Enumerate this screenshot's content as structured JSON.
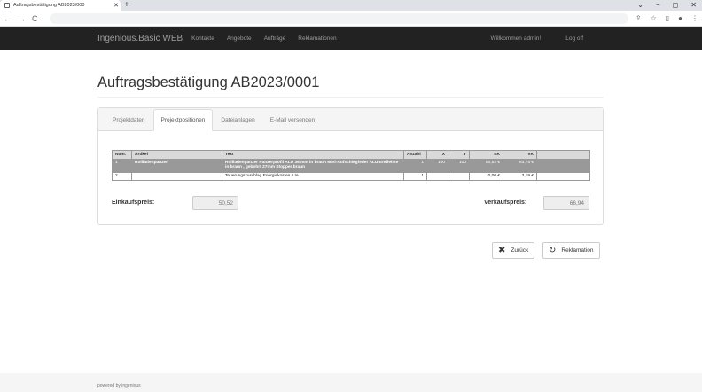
{
  "browser": {
    "tab_title": "Auftragsbestätigung AB2023/000",
    "tab_close": "✕",
    "new_tab": "+",
    "back": "←",
    "forward": "→",
    "reload": "C",
    "win_min": "⌄",
    "win_minimize": "−",
    "win_restore": "◻",
    "win_close": "✕",
    "share_icon": "⇪",
    "star_icon": "☆",
    "sidepanel_icon": "▯",
    "profile_icon": "●",
    "menu_icon": "⋮"
  },
  "navbar": {
    "brand": "Ingenious.Basic WEB",
    "links": [
      "Kontakte",
      "Angebote",
      "Aufträge",
      "Reklamationen"
    ],
    "welcome": "Willkommen admin!",
    "logout": "Log off"
  },
  "page": {
    "title": "Auftragsbestätigung AB2023/0001"
  },
  "tabs": [
    "Projektdaten",
    "Projektpositionen",
    "Dateianlagen",
    "E-Mail versenden"
  ],
  "table": {
    "headers": [
      "Num.",
      "Artikel",
      "Text",
      "Anzahl",
      "X",
      "Y",
      "EK",
      "VK",
      ""
    ],
    "rows": [
      {
        "num": "1",
        "artikel": "Rollladenpanzer",
        "text": "Rollladenpanzer Panzerprofil ALU 36 mm in braun Mini-Aufschiegfeder ALU-Endleiste in braun , gebohrt 27mm Stopper braun",
        "anzahl": "1",
        "x": "100",
        "y": "100",
        "ek": "50,52 €",
        "vk": "63,75 €"
      },
      {
        "num": "2",
        "artikel": "",
        "text": "Teuerungszuschlag Energiekosten 5 %",
        "anzahl": "1",
        "x": "",
        "y": "",
        "ek": "0,00 €",
        "vk": "3,19 €"
      }
    ]
  },
  "summary": {
    "einkauf_label": "Einkaufspreis:",
    "einkauf_value": "50,52",
    "verkauf_label": "Verkaufspreis:",
    "verkauf_value": "66,94"
  },
  "buttons": {
    "back_icon": "✖",
    "back": "Zurück",
    "reklamation_icon": "↻",
    "reklamation": "Reklamation"
  },
  "footer": {
    "text": "powered by ingenious"
  }
}
